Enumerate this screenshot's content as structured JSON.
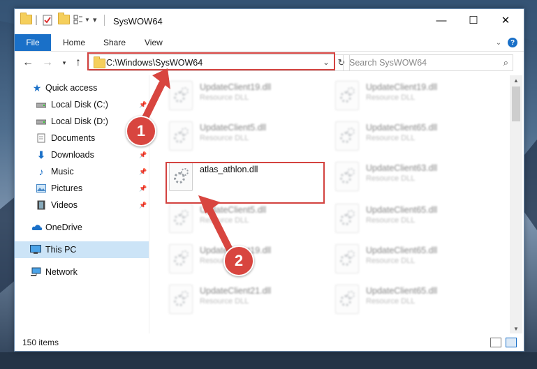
{
  "window": {
    "title": "SysWOW64",
    "controls": {
      "minimize": "—",
      "maximize": "☐",
      "close": "✕"
    }
  },
  "ribbon": {
    "tabs": [
      "File",
      "Home",
      "Share",
      "View"
    ],
    "expand_icon": "chevron-down-icon",
    "help_label": "?"
  },
  "navigation": {
    "back_icon": "arrow-left-icon",
    "forward_icon": "arrow-right-icon",
    "recent_icon": "chevron-down-icon",
    "up_icon": "arrow-up-icon",
    "address": "C:\\Windows\\SysWOW64",
    "search_placeholder": "Search SysWOW64"
  },
  "sidebar": {
    "items": [
      {
        "label": "Quick access",
        "icon": "star-icon"
      },
      {
        "label": "Local Disk (C:)",
        "icon": "drive-icon",
        "pinned": true
      },
      {
        "label": "Local Disk (D:)",
        "icon": "drive-icon",
        "pinned": false
      },
      {
        "label": "Documents",
        "icon": "document-icon",
        "pinned": true
      },
      {
        "label": "Downloads",
        "icon": "download-icon",
        "pinned": true
      },
      {
        "label": "Music",
        "icon": "music-icon",
        "pinned": true
      },
      {
        "label": "Pictures",
        "icon": "picture-icon",
        "pinned": true
      },
      {
        "label": "Videos",
        "icon": "video-icon",
        "pinned": true
      },
      {
        "label": "OneDrive",
        "icon": "cloud-icon"
      },
      {
        "label": "This PC",
        "icon": "computer-icon",
        "selected": true
      },
      {
        "label": "Network",
        "icon": "network-icon"
      }
    ]
  },
  "files": {
    "left": [
      {
        "name": "UpdateClient19.dll",
        "type": "Resource DLL"
      },
      {
        "name": "UpdateClient5.dll",
        "type": "Resource DLL"
      },
      {
        "name": "atlas_athlon.dll",
        "type": ""
      },
      {
        "name": "UpdateClient5.dll",
        "type": "Resource DLL"
      },
      {
        "name": "UpdateClient19.dll",
        "type": "Resource DLL"
      },
      {
        "name": "UpdateClient21.dll",
        "type": "Resource DLL"
      }
    ],
    "right": [
      {
        "name": "UpdateClient19.dll",
        "type": "Resource DLL"
      },
      {
        "name": "UpdateClient65.dll",
        "type": "Resource DLL"
      },
      {
        "name": "UpdateClient63.dll",
        "type": "Resource DLL"
      },
      {
        "name": "UpdateClient65.dll",
        "type": "Resource DLL"
      },
      {
        "name": "UpdateClient65.dll",
        "type": "Resource DLL"
      },
      {
        "name": "UpdateClient65.dll",
        "type": "Resource DLL"
      }
    ]
  },
  "status": {
    "item_count": "150 items"
  },
  "annotations": {
    "step1": "1",
    "step2": "2",
    "accent": "#d8453f"
  }
}
